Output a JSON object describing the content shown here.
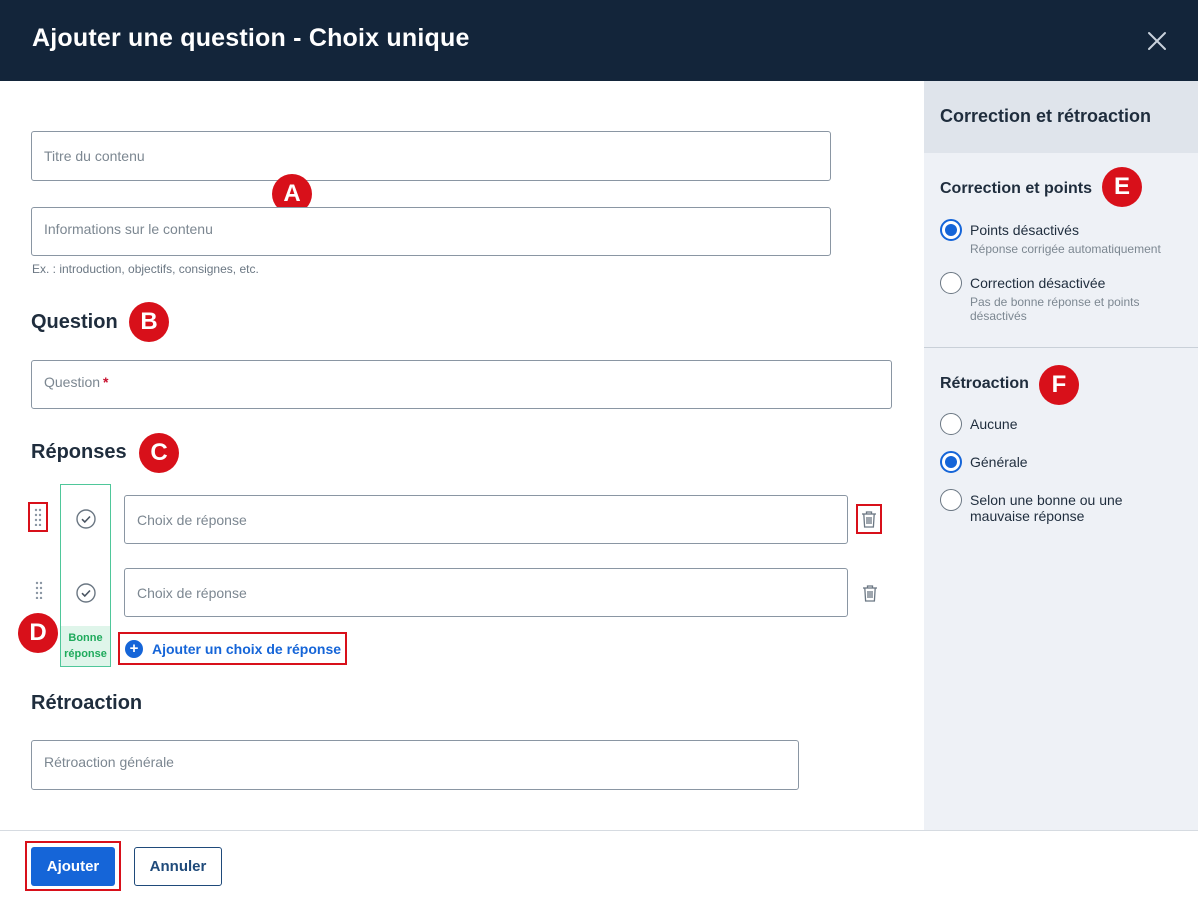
{
  "header": {
    "title": "Ajouter une question - Choix unique"
  },
  "content": {
    "title_field": "Titre du contenu",
    "info_field": "Informations sur le contenu",
    "info_hint": "Ex. : introduction, objectifs, consignes, etc."
  },
  "question": {
    "heading": "Question",
    "field_label": "Question",
    "required_mark": "*"
  },
  "responses": {
    "heading": "Réponses",
    "choices": [
      {
        "placeholder": "Choix de réponse"
      },
      {
        "placeholder": "Choix de réponse"
      }
    ],
    "good_answer_label": "Bonne réponse",
    "add_choice_label": "Ajouter un choix de réponse"
  },
  "feedback": {
    "heading": "Rétroaction",
    "field_label": "Rétroaction générale"
  },
  "sidebar": {
    "heading": "Correction et rétroaction",
    "correction": {
      "heading": "Correction et points",
      "options": [
        {
          "label": "Points désactivés",
          "sub": "Réponse corrigée automatiquement",
          "selected": true
        },
        {
          "label": "Correction désactivée",
          "sub": "Pas de bonne réponse et points désactivés",
          "selected": false
        }
      ]
    },
    "feedback": {
      "heading": "Rétroaction",
      "options": [
        {
          "label": "Aucune",
          "selected": false
        },
        {
          "label": "Générale",
          "selected": true
        },
        {
          "label": "Selon une bonne ou une mauvaise réponse",
          "selected": false
        }
      ]
    }
  },
  "annotations": {
    "a": "A",
    "b": "B",
    "c": "C",
    "d": "D",
    "e": "E",
    "f": "F"
  },
  "footer": {
    "add_label": "Ajouter",
    "cancel_label": "Annuler"
  },
  "colors": {
    "header_bg": "#13253a",
    "primary": "#1565d8",
    "annotation": "#d8101a",
    "good_answer": "#4fc79a"
  }
}
